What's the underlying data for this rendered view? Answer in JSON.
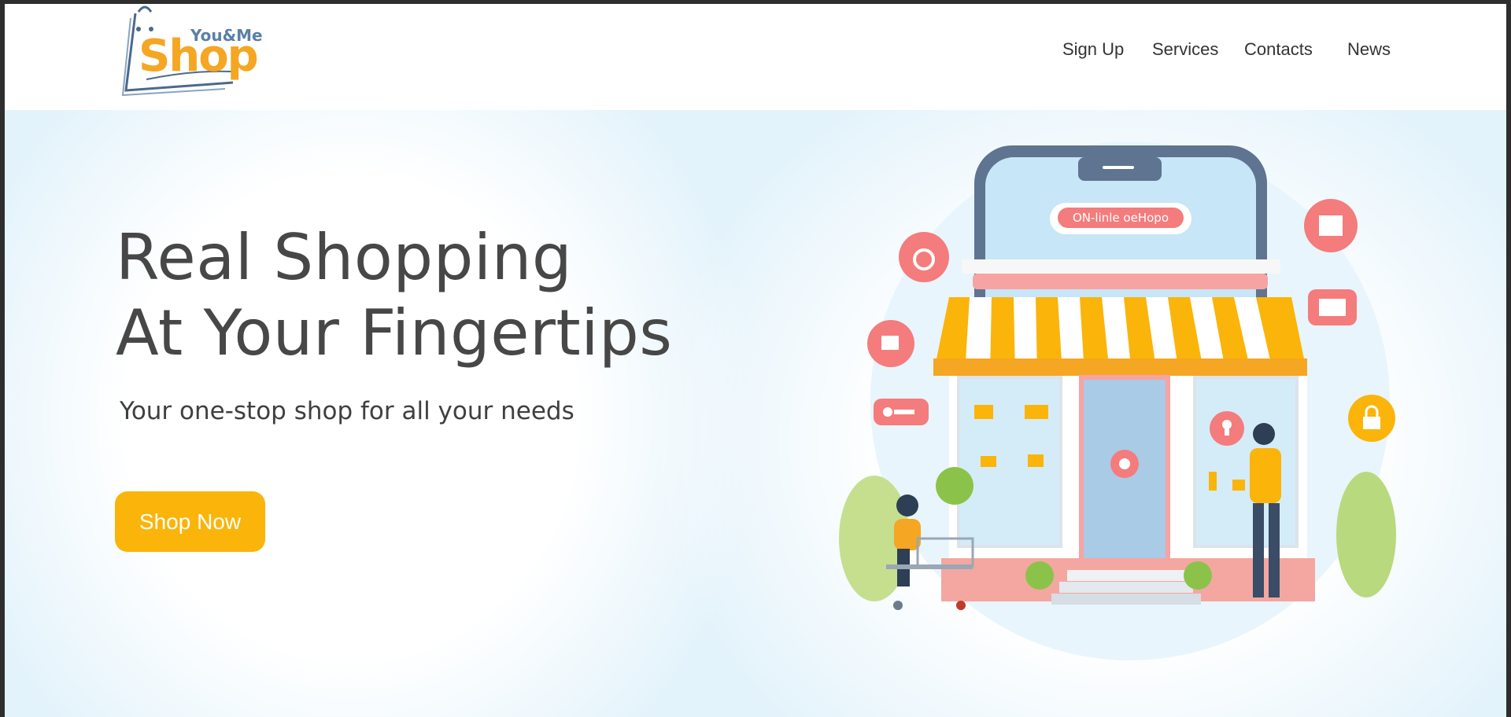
{
  "brand": {
    "tagline_small": "You&Me",
    "name": "Shop"
  },
  "nav": {
    "items": [
      {
        "label": "Sign Up"
      },
      {
        "label": "Services"
      },
      {
        "label": "Contacts"
      },
      {
        "label": "News"
      }
    ]
  },
  "hero": {
    "headline_line1": "Real Shopping",
    "headline_line2": "At Your Fingertips",
    "subtitle": "Your one-stop shop for all your needs",
    "cta_label": "Shop Now",
    "illustration": {
      "sign_text": "ON-linle oeHopo",
      "icons": [
        "ring-icon",
        "card-icon",
        "tag-icon",
        "key-icon",
        "image-icon",
        "cart-icon",
        "lock-icon",
        "location-icon",
        "keyhole-icon"
      ]
    }
  },
  "colors": {
    "accent": "#fbb40a",
    "logo_orange": "#f5a623",
    "logo_blue": "#5b7fa6",
    "hero_bg": "#e3f3fb",
    "text_dark": "#474747",
    "coral": "#f47c7c"
  }
}
